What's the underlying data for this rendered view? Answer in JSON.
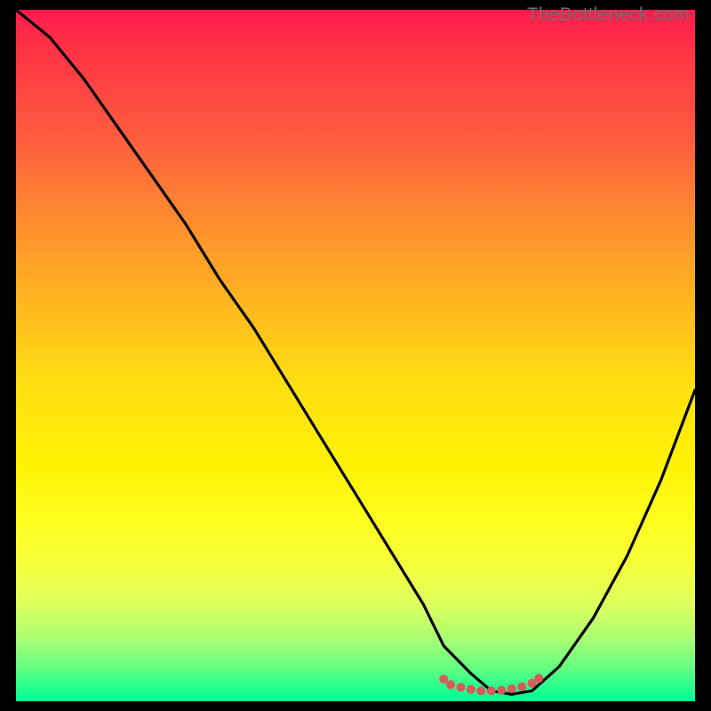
{
  "watermark": "TheBottleneck.com",
  "domain": "Chart",
  "chart_data": {
    "type": "line",
    "title": "",
    "xlabel": "",
    "ylabel": "",
    "xlim": [
      0,
      100
    ],
    "ylim": [
      0,
      100
    ],
    "series": [
      {
        "name": "bottleneck-curve",
        "x": [
          0,
          5,
          10,
          15,
          20,
          25,
          30,
          35,
          40,
          45,
          50,
          55,
          60,
          63,
          67,
          70,
          73,
          76,
          80,
          85,
          90,
          95,
          100
        ],
        "values": [
          100,
          96,
          90,
          83,
          76,
          69,
          61,
          54,
          46,
          38,
          30,
          22,
          14,
          8,
          4,
          1.5,
          1,
          1.5,
          5,
          12,
          21,
          32,
          45
        ]
      }
    ],
    "markers": {
      "name": "flat-region-dots",
      "color": "#d85a5a",
      "points": [
        {
          "x": 63,
          "y": 3.2
        },
        {
          "x": 64,
          "y": 2.4
        },
        {
          "x": 65.5,
          "y": 2.0
        },
        {
          "x": 67,
          "y": 1.7
        },
        {
          "x": 68.5,
          "y": 1.5
        },
        {
          "x": 70,
          "y": 1.5
        },
        {
          "x": 71.5,
          "y": 1.6
        },
        {
          "x": 73,
          "y": 1.8
        },
        {
          "x": 74.5,
          "y": 2.1
        },
        {
          "x": 76,
          "y": 2.6
        },
        {
          "x": 77,
          "y": 3.3
        }
      ]
    },
    "gradient_stops": [
      {
        "pos": 0,
        "color": "#ff1a4c"
      },
      {
        "pos": 50,
        "color": "#ffde12"
      },
      {
        "pos": 80,
        "color": "#f6ff3a"
      },
      {
        "pos": 100,
        "color": "#00ff95"
      }
    ]
  }
}
